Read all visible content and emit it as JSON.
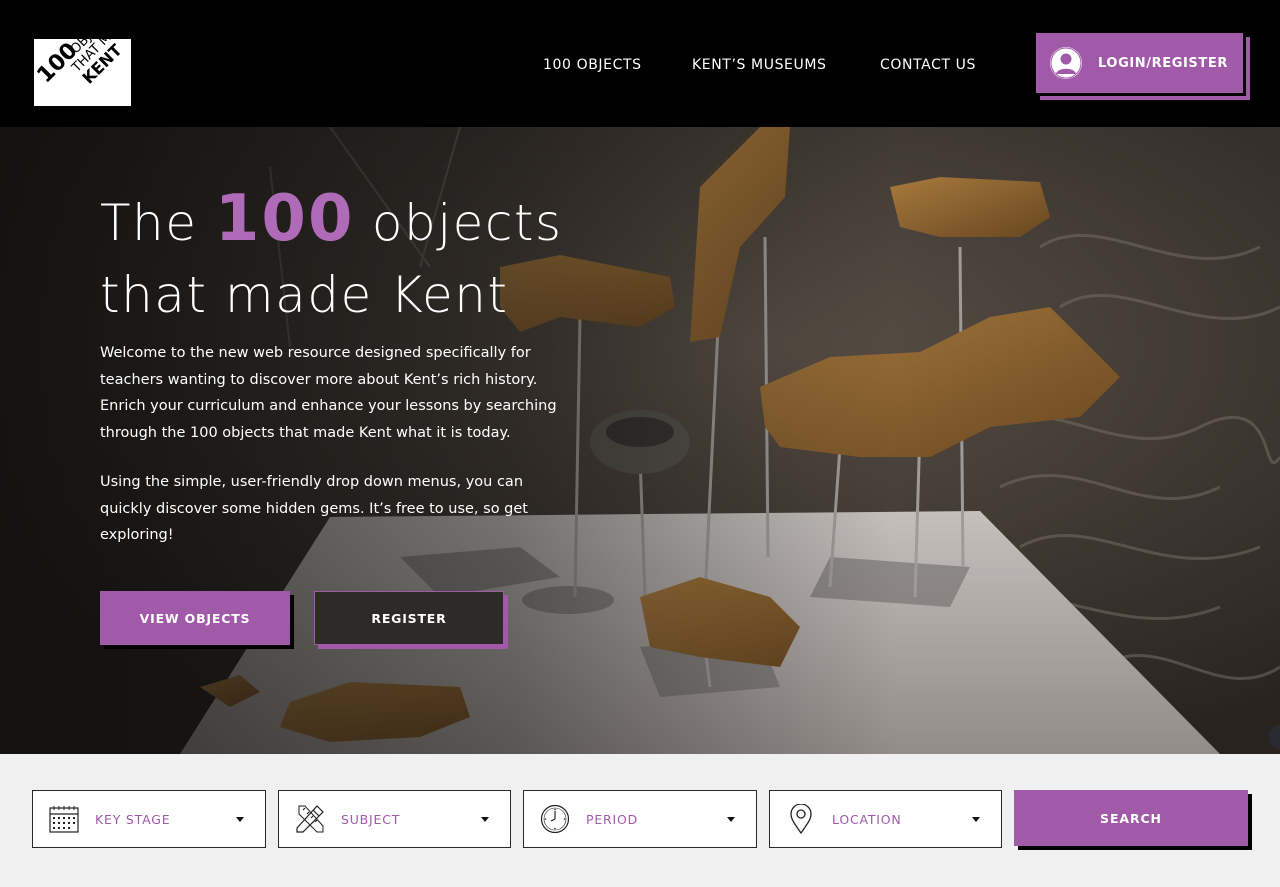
{
  "header": {
    "logo": {
      "line1": "100",
      "line2": "OBJECTS",
      "line3": "THAT MADE",
      "line4": "KENT"
    },
    "nav": [
      "100 OBJECTS",
      "KENT’S MUSEUMS",
      "CONTACT US"
    ],
    "login_label": "LOGIN/REGISTER"
  },
  "hero": {
    "title_pre": "The ",
    "title_num": "100",
    "title_post": " objects",
    "title_line2": "that made Kent",
    "paragraph1": "Welcome to the new web resource designed specifically for teachers wanting to discover more about Kent’s rich history. Enrich your curriculum and enhance your lessons by searching through the 100 objects that made Kent what it is today.",
    "paragraph2": "Using the simple, user-friendly drop down menus, you can quickly discover some hidden gems. It’s free to use, so get exploring!",
    "view_button": "VIEW OBJECTS",
    "register_button": "REGISTER"
  },
  "filters": {
    "key_stage": {
      "label": "KEY STAGE",
      "icon": "calendar-icon"
    },
    "subject": {
      "label": "SUBJECT",
      "icon": "pencil-ruler-icon"
    },
    "period": {
      "label": "PERIOD",
      "icon": "clock-icon"
    },
    "location": {
      "label": "LOCATION",
      "icon": "map-pin-icon"
    },
    "search_button": "SEARCH"
  },
  "colors": {
    "accent": "#a05aa8",
    "header_bg": "#000000",
    "filter_bg": "#f0f0f0"
  }
}
